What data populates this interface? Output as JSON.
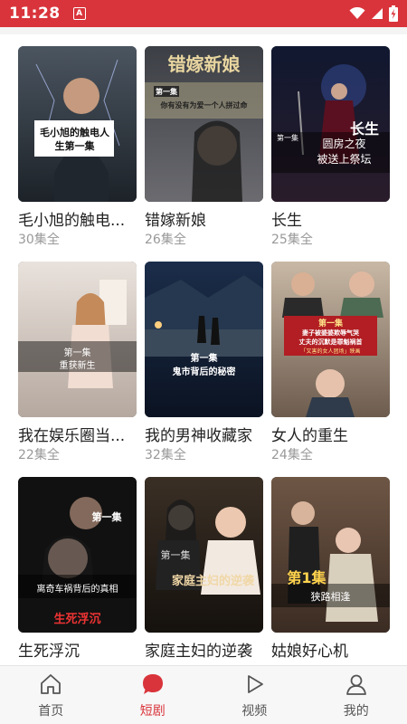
{
  "status": {
    "time": "11:28",
    "notif_glyph": "A"
  },
  "cards": [
    {
      "title": "毛小旭的触电...",
      "episodes": "30集全",
      "cover_text": "毛小旭的触电人\n生第一集"
    },
    {
      "title": "错嫁新娘",
      "episodes": "26集全",
      "cover_heading": "错嫁新娘",
      "cover_tag": "第一集",
      "cover_sub": "你有没有为爱一个人拼过命"
    },
    {
      "title": "长生",
      "episodes": "25集全",
      "cover_heading": "长生",
      "cover_tag": "第一集",
      "cover_sub": "圆房之夜\n被送上祭坛"
    },
    {
      "title": "我在娱乐圈当...",
      "episodes": "22集全",
      "cover_tag": "第一集",
      "cover_sub": "重获新生"
    },
    {
      "title": "我的男神收藏家",
      "episodes": "32集全",
      "cover_tag": "第一集",
      "cover_sub": "鬼市背后的秘密"
    },
    {
      "title": "女人的重生",
      "episodes": "24集全",
      "cover_tag": "第一集",
      "cover_sub": "妻子被婆婆欺辱气哭",
      "cover_sub2": "丈夫的沉默是罪魁祸首",
      "cover_sub3": "「又害的女人团场」映画"
    },
    {
      "title": "生死浮沉",
      "episodes": "",
      "cover_tag": "第一集",
      "cover_sub": "离奇车祸背后的真相",
      "cover_heading": "生死浮沉"
    },
    {
      "title": "家庭主妇的逆袭",
      "episodes": "",
      "cover_tag": "第一集",
      "cover_heading": "家庭主妇的逆袭"
    },
    {
      "title": "姑娘好心机",
      "episodes": "",
      "cover_tag": "第1集",
      "cover_sub": "狭路相逢"
    }
  ],
  "nav": [
    {
      "label": "首页",
      "icon": "home-icon",
      "active": false
    },
    {
      "label": "短剧",
      "icon": "short-drama-icon",
      "active": true
    },
    {
      "label": "视频",
      "icon": "play-icon",
      "active": false
    },
    {
      "label": "我的",
      "icon": "profile-icon",
      "active": false
    }
  ],
  "colors": {
    "accent": "#d9343b",
    "text": "#222222",
    "muted": "#999999"
  }
}
